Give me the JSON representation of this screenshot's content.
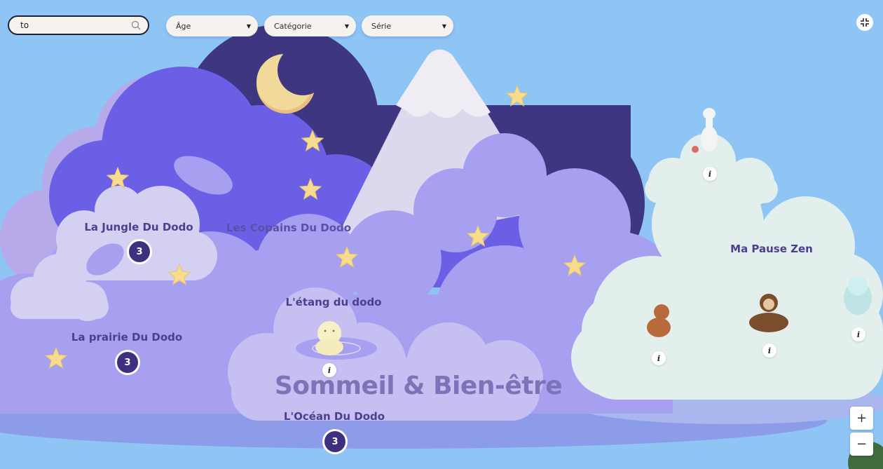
{
  "search": {
    "value": "to"
  },
  "filters": [
    {
      "label": "Âge"
    },
    {
      "label": "Catégorie"
    },
    {
      "label": "Série"
    }
  ],
  "map": {
    "title": "Sommeil & Bien-être",
    "areas": [
      {
        "name": "La Jungle Du Dodo",
        "count": "3"
      },
      {
        "name": "Les Copains Du Dodo"
      },
      {
        "name": "L'étang du dodo",
        "info": "i"
      },
      {
        "name": "La prairie Du Dodo",
        "count": "3"
      },
      {
        "name": "L'Océan Du Dodo",
        "count": "3"
      },
      {
        "name": "Ma Pause Zen"
      }
    ],
    "figurine_info": [
      "i",
      "i",
      "i",
      "i"
    ]
  },
  "zoom": {
    "in": "+",
    "out": "−"
  },
  "colors": {
    "background": "#8ec5f4",
    "night": "#3f3682",
    "cloud_purple": "#6b5fe6",
    "cloud_lilac": "#a79ff0",
    "cloud_mint": "#e3efec",
    "star": "#f6dc8c",
    "moon": "#f1d99a",
    "badge": "#3f2f80"
  }
}
